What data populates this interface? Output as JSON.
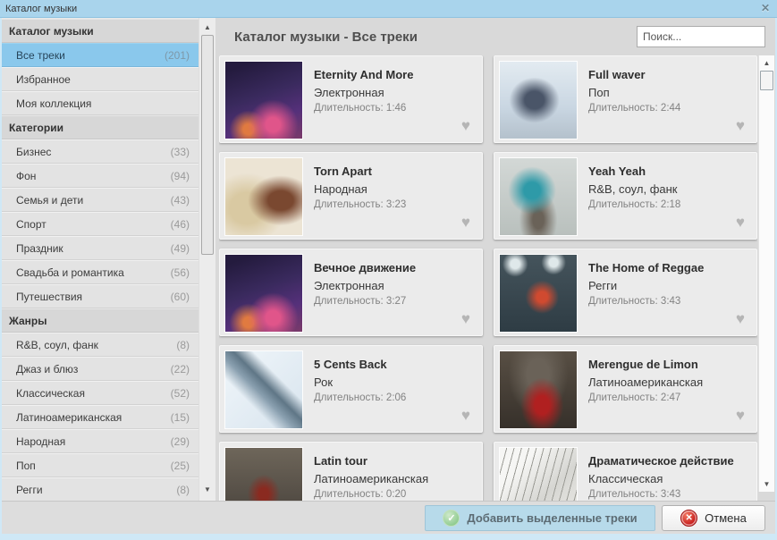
{
  "window": {
    "title": "Каталог музыки"
  },
  "icons": {
    "close": "✕",
    "heart": "♥",
    "check": "✓",
    "cancel": "✕",
    "scroll_up": "▲",
    "scroll_down": "▼"
  },
  "sidebar": {
    "items": [
      {
        "type": "header",
        "label": "Каталог музыки",
        "count": ""
      },
      {
        "type": "item",
        "label": "Все треки",
        "count": "(201)",
        "selected": true
      },
      {
        "type": "item",
        "label": "Избранное",
        "count": ""
      },
      {
        "type": "item",
        "label": "Моя коллекция",
        "count": ""
      },
      {
        "type": "header",
        "label": "Категории",
        "count": ""
      },
      {
        "type": "item",
        "label": "Бизнес",
        "count": "(33)"
      },
      {
        "type": "item",
        "label": "Фон",
        "count": "(94)"
      },
      {
        "type": "item",
        "label": "Семья и дети",
        "count": "(43)"
      },
      {
        "type": "item",
        "label": "Спорт",
        "count": "(46)"
      },
      {
        "type": "item",
        "label": "Праздник",
        "count": "(49)"
      },
      {
        "type": "item",
        "label": "Свадьба и романтика",
        "count": "(56)"
      },
      {
        "type": "item",
        "label": "Путешествия",
        "count": "(60)"
      },
      {
        "type": "header",
        "label": "Жанры",
        "count": ""
      },
      {
        "type": "item",
        "label": "R&B, соул, фанк",
        "count": "(8)"
      },
      {
        "type": "item",
        "label": "Джаз и блюз",
        "count": "(22)"
      },
      {
        "type": "item",
        "label": "Классическая",
        "count": "(52)"
      },
      {
        "type": "item",
        "label": "Латиноамериканская",
        "count": "(15)"
      },
      {
        "type": "item",
        "label": "Народная",
        "count": "(29)"
      },
      {
        "type": "item",
        "label": "Поп",
        "count": "(25)"
      },
      {
        "type": "item",
        "label": "Регги",
        "count": "(8)"
      }
    ]
  },
  "main": {
    "heading": "Каталог музыки - Все треки",
    "search_placeholder": "Поиск...",
    "tracks": [
      {
        "title": "Eternity And More",
        "genre": "Электронная",
        "duration": "Длительность: 1:46",
        "art": "dj"
      },
      {
        "title": "Full waver",
        "genre": "Поп",
        "duration": "Длительность: 2:44",
        "art": "street"
      },
      {
        "title": "Torn Apart",
        "genre": "Народная",
        "duration": "Длительность: 3:23",
        "art": "instruments"
      },
      {
        "title": "Yeah Yeah",
        "genre": "R&B, соул, фанк",
        "duration": "Длительность: 2:18",
        "art": "skater"
      },
      {
        "title": "Вечное движение",
        "genre": "Электронная",
        "duration": "Длительность: 3:27",
        "art": "dj"
      },
      {
        "title": "The Home of Reggae",
        "genre": "Регги",
        "duration": "Длительность: 3:43",
        "art": "reggae"
      },
      {
        "title": "5 Cents Back",
        "genre": "Рок",
        "duration": "Длительность: 2:06",
        "art": "guitar"
      },
      {
        "title": "Merengue de Limon",
        "genre": "Латиноамериканская",
        "duration": "Длительность: 2:47",
        "art": "dancers"
      },
      {
        "title": "Latin tour",
        "genre": "Латиноамериканская",
        "duration": "Длительность: 0:20",
        "art": "latin"
      },
      {
        "title": "Драматическое действие",
        "genre": "Классическая",
        "duration": "Длительность: 3:43",
        "art": "sheet"
      }
    ]
  },
  "footer": {
    "add_label": "Добавить выделенные треки",
    "cancel_label": "Отмена"
  },
  "colors": {
    "titlebar": "#a9d4ec",
    "selected_item": "#8ac8ec",
    "add_button": "#b7daea",
    "check_green": "#8fcb8f",
    "cancel_red": "#c51717",
    "heart": "#b5b5b5"
  }
}
